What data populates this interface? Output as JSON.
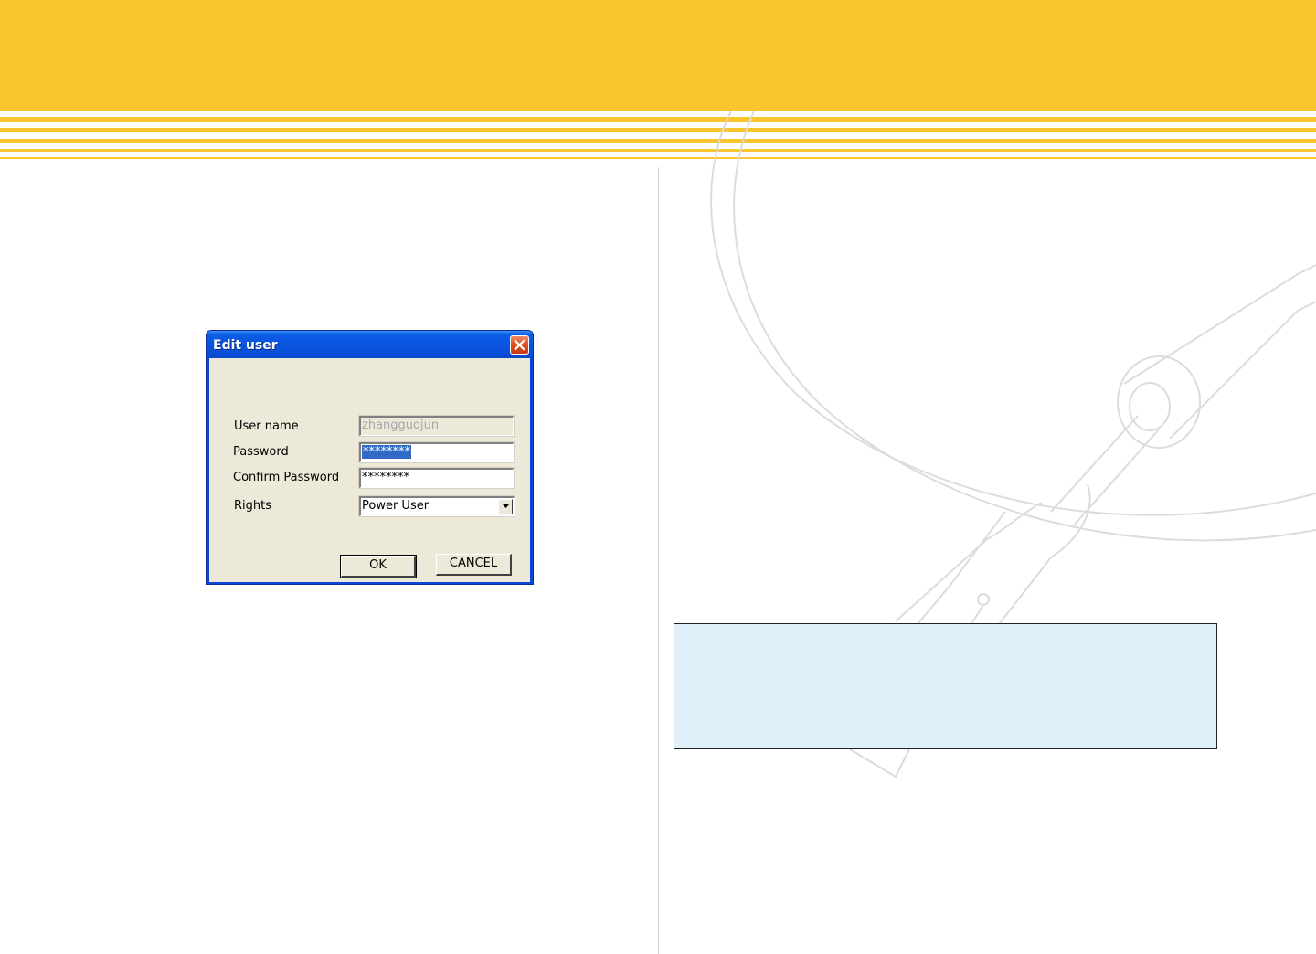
{
  "dialog": {
    "title": "Edit user",
    "close_icon": "close-icon",
    "fields": {
      "username_label": "User name",
      "username_value": "zhangguojun",
      "password_label": "Password",
      "password_value": "********",
      "confirm_label": "Confirm Password",
      "confirm_value": "********",
      "rights_label": "Rights",
      "rights_value": "Power User"
    },
    "buttons": {
      "ok": "OK",
      "cancel": "CANCEL"
    }
  },
  "colors": {
    "header_yellow": "#f9c42c",
    "note_box": "#dff0fb",
    "dialog_face": "#ece9d8",
    "titlebar_blue": "#0a55df",
    "selection_blue": "#316ac5"
  }
}
